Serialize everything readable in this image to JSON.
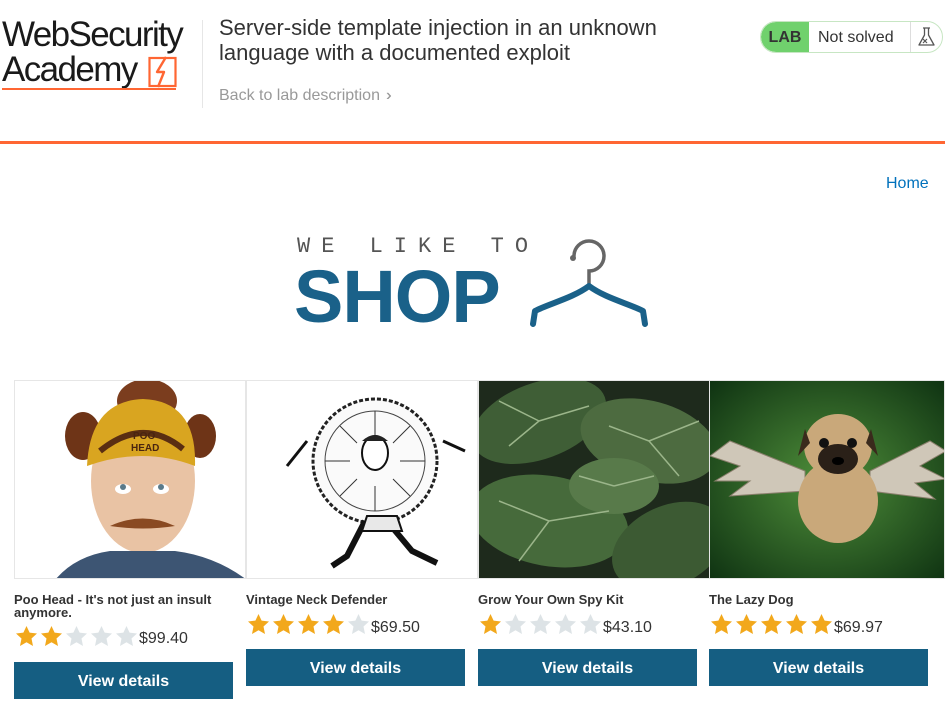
{
  "header": {
    "logo_line1": "WebSecurity",
    "logo_line2": "Academy",
    "lab_title": "Server-side template injection in an unknown language with a documented exploit",
    "back_link": "Back to lab description",
    "lab_badge": "LAB",
    "lab_status": "Not solved"
  },
  "nav": {
    "home": "Home"
  },
  "hero": {
    "small": "WE LIKE TO",
    "big": "SHOP"
  },
  "colors": {
    "accent_orange": "#ff6633",
    "button_blue": "#155e82",
    "link_blue": "#0071bc",
    "star_gold": "#f2a81c",
    "star_empty": "#dde3e6",
    "lab_green": "#70d16d"
  },
  "products": [
    {
      "name": "Poo Head - It's not just an insult anymore.",
      "rating": 2,
      "price": "$99.40",
      "button": "View details"
    },
    {
      "name": "Vintage Neck Defender",
      "rating": 4,
      "price": "$69.50",
      "button": "View details"
    },
    {
      "name": "Grow Your Own Spy Kit",
      "rating": 1,
      "price": "$43.10",
      "button": "View details"
    },
    {
      "name": "The Lazy Dog",
      "rating": 5,
      "price": "$69.97",
      "button": "View details"
    }
  ]
}
